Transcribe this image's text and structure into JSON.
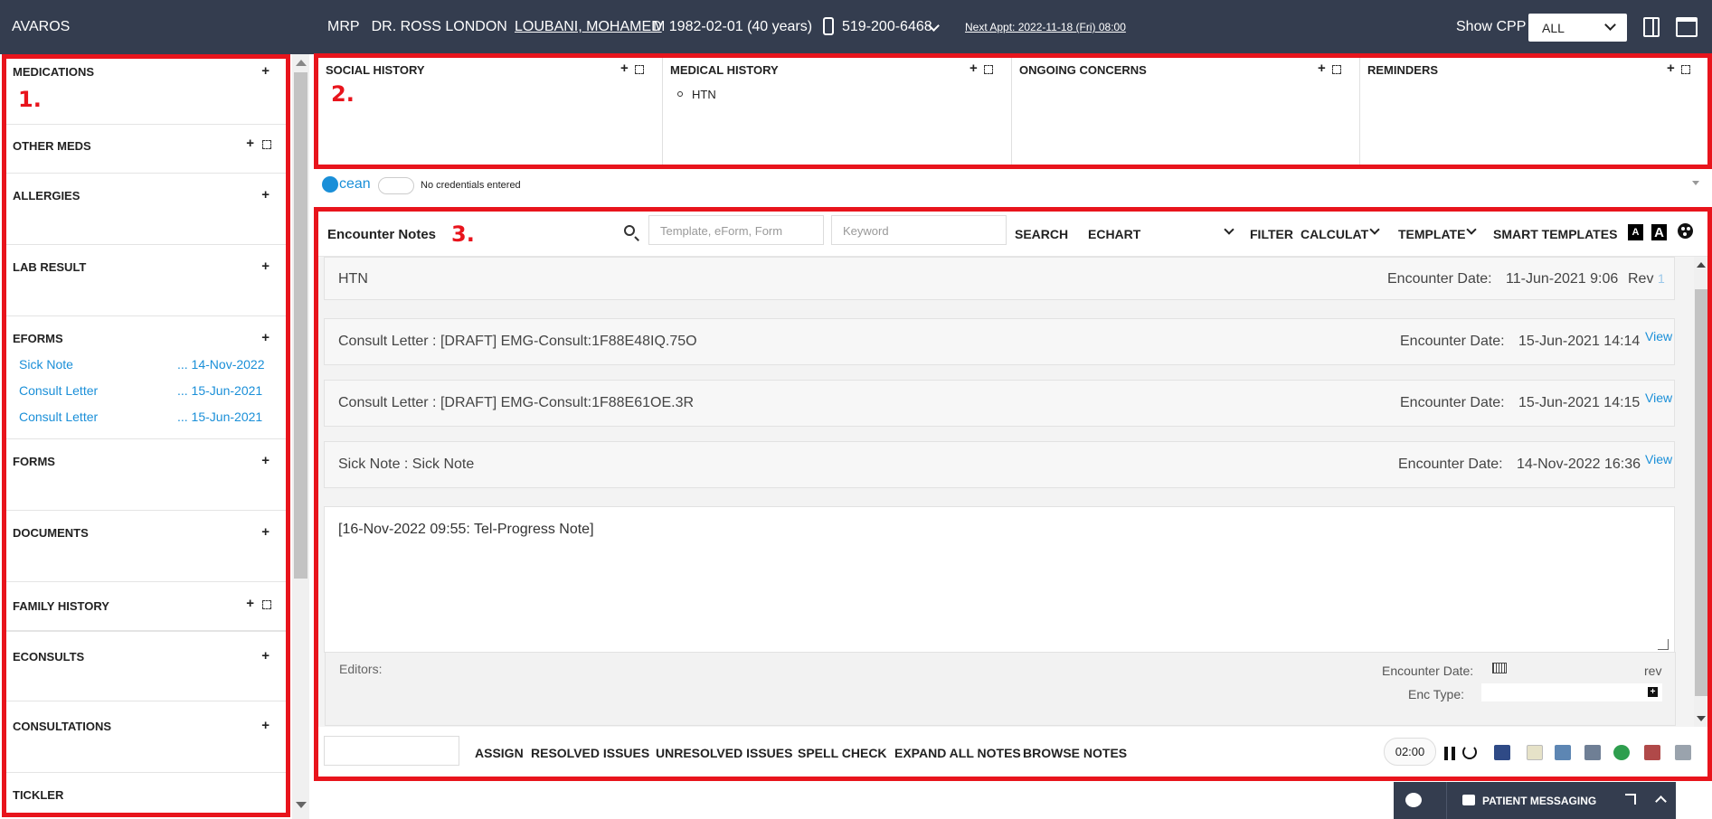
{
  "topbar": {
    "brand": "AVAROS",
    "mrp": "MRP   DR. ROSS LONDON",
    "patient": "LOUBANI, MOHAMED",
    "demographics": "M 1982-02-01 (40 years)",
    "phone": "519-200-6468",
    "next_appt": "Next Appt: 2022-11-18 (Fri) 08:00",
    "show_cpp_label": "Show CPP",
    "show_cpp_value": "ALL"
  },
  "markers": {
    "one": "1.",
    "two": "2.",
    "three": "3."
  },
  "left_panel": {
    "sections": [
      {
        "title": "MEDICATIONS"
      },
      {
        "title": "OTHER MEDS"
      },
      {
        "title": "ALLERGIES"
      },
      {
        "title": "LAB RESULT"
      },
      {
        "title": "EFORMS"
      },
      {
        "title": "FORMS"
      },
      {
        "title": "DOCUMENTS"
      },
      {
        "title": "FAMILY HISTORY"
      },
      {
        "title": "ECONSULTS"
      },
      {
        "title": "CONSULTATIONS"
      },
      {
        "title": "TICKLER"
      }
    ],
    "plus": "+",
    "eforms": [
      {
        "name": "Sick Note",
        "date": "... 14-Nov-2022"
      },
      {
        "name": "Consult Letter",
        "date": "... 15-Jun-2021"
      },
      {
        "name": "Consult Letter",
        "date": "... 15-Jun-2021"
      }
    ]
  },
  "cpp": {
    "columns": [
      {
        "title": "SOCIAL HISTORY"
      },
      {
        "title": "MEDICAL HISTORY",
        "item": "HTN"
      },
      {
        "title": "ONGOING CONCERNS"
      },
      {
        "title": "REMINDERS"
      }
    ]
  },
  "ocean": {
    "logo": "cean",
    "status": "No credentials entered"
  },
  "encounter": {
    "title": "Encounter Notes",
    "template_placeholder": "Template, eForm, Form",
    "keyword_placeholder": "Keyword",
    "search": "SEARCH",
    "echart": "ECHART",
    "filter": "FILTER",
    "calculat": "CALCULAT",
    "template": "TEMPLATE",
    "smart_templates": "SMART TEMPLATES",
    "font_a": "A",
    "date_label": "Encounter Date:",
    "view": "View",
    "notes": [
      {
        "text": "HTN",
        "date": "11-Jun-2021 9:06",
        "rev": "Rev",
        "rev_num": "1"
      },
      {
        "text": "Consult Letter : [DRAFT] EMG-Consult:1F88E48IQ.75O",
        "date": "15-Jun-2021 14:14"
      },
      {
        "text": "Consult Letter : [DRAFT] EMG-Consult:1F88E61OE.3R",
        "date": "15-Jun-2021 14:15"
      },
      {
        "text": "Sick Note : Sick Note",
        "date": "14-Nov-2022 16:36"
      }
    ],
    "current_note": {
      "text": "[16-Nov-2022 09:55: Tel-Progress Note]",
      "editors": "Editors:",
      "encounter_date": "Encounter Date:",
      "rev": "rev",
      "enc_type": "Enc Type:",
      "plus": "+"
    },
    "footer": {
      "assign": "ASSIGN",
      "resolved": "RESOLVED ISSUES",
      "unresolved": "UNRESOLVED ISSUES",
      "spell": "SPELL CHECK",
      "expand": "EXPAND ALL NOTES",
      "browse": "BROWSE NOTES",
      "timer": "02:00"
    }
  },
  "messaging": {
    "label": "PATIENT MESSAGING"
  },
  "colors": {
    "topbar": "#343d4f",
    "highlight": "#e8141c",
    "link": "#1a8fd8"
  }
}
